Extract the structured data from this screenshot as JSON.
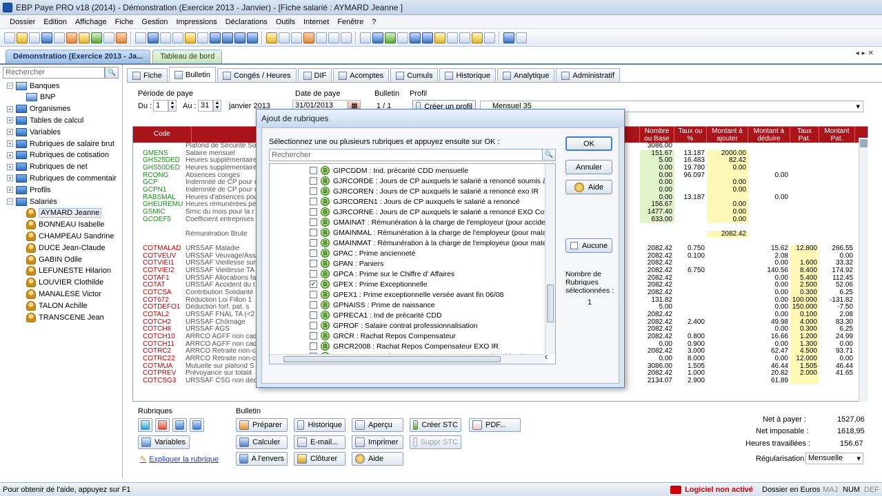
{
  "window": {
    "title": "EBP Paye PRO v18 (2014) - Démonstration (Exercice 2013 - Janvier) - [Fiche salarié : AYMARD Jeanne ]"
  },
  "menu": [
    "Dossier",
    "Edition",
    "Affichage",
    "Fiche",
    "Gestion",
    "Impressions",
    "Déclarations",
    "Outils",
    "Internet",
    "Fenêtre",
    "?"
  ],
  "doc_tabs": [
    {
      "label": "Démonstration (Exercice 2013 - Ja...",
      "active": true
    },
    {
      "label": "Tableau de bord",
      "active": false
    }
  ],
  "sidebar": {
    "search_placeholder": "Rechercher",
    "tree": [
      {
        "label": "Banques",
        "type": "bank",
        "expanded": true,
        "level": 0
      },
      {
        "label": "BNP",
        "type": "bank",
        "level": 1
      },
      {
        "label": "Organismes",
        "type": "folder",
        "level": 0
      },
      {
        "label": "Tables de calcul",
        "type": "folder",
        "level": 0
      },
      {
        "label": "Variables",
        "type": "folder",
        "level": 0
      },
      {
        "label": "Rubriques de salaire brut",
        "type": "folder",
        "level": 0
      },
      {
        "label": "Rubriques de cotisation",
        "type": "folder",
        "level": 0
      },
      {
        "label": "Rubriques de net",
        "type": "folder",
        "level": 0
      },
      {
        "label": "Rubriques de commentair",
        "type": "folder",
        "level": 0
      },
      {
        "label": "Profils",
        "type": "folder",
        "level": 0
      },
      {
        "label": "Salariés",
        "type": "folder",
        "expanded": true,
        "level": 0
      },
      {
        "label": "AYMARD Jeanne",
        "type": "person",
        "level": 1,
        "selected": true
      },
      {
        "label": "BONNEAU Isabelle",
        "type": "person",
        "level": 1
      },
      {
        "label": "CHAMPEAU Sandrine",
        "type": "person",
        "level": 1
      },
      {
        "label": "DUCE Jean-Claude",
        "type": "person",
        "level": 1
      },
      {
        "label": "GABIN Odile",
        "type": "person",
        "level": 1
      },
      {
        "label": "LEFUNESTE Hilarion",
        "type": "person",
        "level": 1
      },
      {
        "label": "LOUVIER Clothilde",
        "type": "person",
        "level": 1
      },
      {
        "label": "MANALESE Victor",
        "type": "person",
        "level": 1
      },
      {
        "label": "TALON Achille",
        "type": "person",
        "level": 1
      },
      {
        "label": "TRANSCENE Jean",
        "type": "person",
        "level": 1
      }
    ]
  },
  "sub_tabs": [
    "Fiche",
    "Bulletin",
    "Congés / Heures",
    "DIF",
    "Acomptes",
    "Cumuls",
    "Historique",
    "Analytique",
    "Administratif"
  ],
  "period": {
    "label": "Période de paye",
    "du_label": "Du :",
    "du": "1",
    "au_label": "Au :",
    "au": "31",
    "month": "janvier 2013",
    "date_label": "Date de paye",
    "date": "31/01/2013",
    "bulletin_label": "Bulletin",
    "bulletin": "1 / 1",
    "profil_label": "Profil",
    "create_profil": "Créer un profil",
    "profil": "Mensuel 35"
  },
  "grid": {
    "headers": {
      "code": "Code",
      "base": "Nombre ou Base",
      "taux": "Taux ou %",
      "ajouter": "Montant à ajouter",
      "deduire": "Montant à déduire",
      "tauxpat": "Taux Pat.",
      "montpat": "Montant Pat."
    },
    "rows": [
      {
        "code": "",
        "lib": "Plafond de Sécurité So",
        "base": "3086.00",
        "taux": "",
        "aj": "",
        "de": "",
        "tp": "",
        "mp": "",
        "g": false
      },
      {
        "code": "GMENS",
        "lib": "Salaire mensuel",
        "base": "151.67",
        "taux": "13.187",
        "aj": "2000.00",
        "de": "",
        "tp": "",
        "mp": "",
        "g": true
      },
      {
        "code": "GHS25DED",
        "lib": "Heures supplémentaire",
        "base": "5.00",
        "taux": "16.483",
        "aj": "82.42",
        "de": "",
        "tp": "",
        "mp": "",
        "g": true
      },
      {
        "code": "GHS50DED",
        "lib": "Heures supplémentaire",
        "base": "0.00",
        "taux": "19.780",
        "aj": "0.00",
        "de": "",
        "tp": "",
        "mp": "",
        "g": true
      },
      {
        "code": "RCONG",
        "lib": "Absences congés",
        "base": "0.00",
        "taux": "96.097",
        "aj": "",
        "de": "0.00",
        "tp": "",
        "mp": "",
        "g": true
      },
      {
        "code": "GCP",
        "lib": "Indemnité de CP pour c",
        "base": "0.00",
        "taux": "",
        "aj": "0.00",
        "de": "",
        "tp": "",
        "mp": "",
        "g": true
      },
      {
        "code": "GCPN1",
        "lib": "Indemnité de CP pour c",
        "base": "0.00",
        "taux": "",
        "aj": "0.00",
        "de": "",
        "tp": "",
        "mp": "",
        "g": true
      },
      {
        "code": "RABSMAL",
        "lib": "Heures d'absences pou",
        "base": "0.00",
        "taux": "13.187",
        "aj": "",
        "de": "0.00",
        "tp": "",
        "mp": "",
        "g": true
      },
      {
        "code": "GHEUREMU",
        "lib": "Heures rémunérées pe",
        "base": "156.67",
        "taux": "",
        "aj": "0.00",
        "de": "",
        "tp": "",
        "mp": "",
        "g": true
      },
      {
        "code": "GSMIC",
        "lib": "Smic du mois pour la r",
        "base": "1477.40",
        "taux": "",
        "aj": "0.00",
        "de": "",
        "tp": "",
        "mp": "",
        "g": true
      },
      {
        "code": "GCOEF5",
        "lib": "Coefficient entreprises",
        "base": "633.00",
        "taux": "",
        "aj": "0.00",
        "de": "",
        "tp": "",
        "mp": "",
        "g": true
      },
      {
        "code": "",
        "lib": "",
        "base": "",
        "taux": "",
        "aj": "",
        "de": "",
        "tp": "",
        "mp": "",
        "g": false
      },
      {
        "code": "",
        "lib": "Rémunération Brute",
        "base": "",
        "taux": "",
        "aj": "2082.42",
        "de": "",
        "tp": "",
        "mp": "",
        "g": false
      },
      {
        "code": "",
        "lib": "",
        "base": "",
        "taux": "",
        "aj": "",
        "de": "",
        "tp": "",
        "mp": "",
        "g": false
      },
      {
        "code": "COTMALAD",
        "lib": "URSSAF Maladie",
        "base": "2082.42",
        "taux": "0.750",
        "aj": "",
        "de": "15.62",
        "tp": "12.800",
        "mp": "266.55",
        "g": false
      },
      {
        "code": "COTVEUV",
        "lib": "URSSAF Veuvage/Ass",
        "base": "2082.42",
        "taux": "0.100",
        "aj": "",
        "de": "2.08",
        "tp": "",
        "mp": "0.00",
        "g": false
      },
      {
        "code": "COTVIEI1",
        "lib": "URSSAF Vieillesse sur",
        "base": "2082.42",
        "taux": "",
        "aj": "",
        "de": "0.00",
        "tp": "1.600",
        "mp": "33.32",
        "g": false
      },
      {
        "code": "COTVIEI2",
        "lib": "URSSAF Vieillesse TA",
        "base": "2082.42",
        "taux": "6.750",
        "aj": "",
        "de": "140.56",
        "tp": "8.400",
        "mp": "174.92",
        "g": false
      },
      {
        "code": "COTAF1",
        "lib": "URSSAF Allocations fa",
        "base": "2082.42",
        "taux": "",
        "aj": "",
        "de": "0.00",
        "tp": "5.400",
        "mp": "112.45",
        "g": false
      },
      {
        "code": "COTAT",
        "lib": "URSSAF Accident du t",
        "base": "2082.42",
        "taux": "",
        "aj": "",
        "de": "0.00",
        "tp": "2.500",
        "mp": "52.06",
        "g": false
      },
      {
        "code": "COTCSA",
        "lib": "Contribution Solidarité",
        "base": "2082.42",
        "taux": "",
        "aj": "",
        "de": "0.00",
        "tp": "0.300",
        "mp": "6.25",
        "g": false
      },
      {
        "code": "COT672",
        "lib": "Réduction Loi Fillon 1",
        "base": "131.82",
        "taux": "",
        "aj": "",
        "de": "0.00",
        "tp": "100.000",
        "mp": "-131.82",
        "g": false
      },
      {
        "code": "COTDEFO1",
        "lib": "Déduction forf. pat. s",
        "base": "5.00",
        "taux": "",
        "aj": "",
        "de": "0.00",
        "tp": "150.000",
        "mp": "-7.50",
        "g": false
      },
      {
        "code": "COTAL2",
        "lib": "URSSAF FNAL TA (<2",
        "base": "2082.42",
        "taux": "",
        "aj": "",
        "de": "0.00",
        "tp": "0.100",
        "mp": "2.08",
        "g": false
      },
      {
        "code": "COTCH2",
        "lib": "URSSAF Chômage",
        "base": "2082.42",
        "taux": "2.400",
        "aj": "",
        "de": "49.98",
        "tp": "4.000",
        "mp": "83.30",
        "g": false
      },
      {
        "code": "COTCH8",
        "lib": "URSSAF AGS",
        "base": "2082.42",
        "taux": "",
        "aj": "",
        "de": "0.00",
        "tp": "0.300",
        "mp": "6.25",
        "g": false
      },
      {
        "code": "COTCH10",
        "lib": "ARRCO AGFF non cad",
        "base": "2082.42",
        "taux": "0.800",
        "aj": "",
        "de": "16.66",
        "tp": "1.200",
        "mp": "24.99",
        "g": false
      },
      {
        "code": "COTCH11",
        "lib": "ARRCO AGFF non cad",
        "base": "0.00",
        "taux": "0.900",
        "aj": "",
        "de": "0.00",
        "tp": "1.300",
        "mp": "0.00",
        "g": false
      },
      {
        "code": "COTRC2",
        "lib": "ARRCO Retraite non-c",
        "base": "2082.42",
        "taux": "3.000",
        "aj": "",
        "de": "62.47",
        "tp": "4.500",
        "mp": "93.71",
        "g": false
      },
      {
        "code": "COTRC22",
        "lib": "ARRCO Retraite non-c",
        "base": "0.00",
        "taux": "8.000",
        "aj": "",
        "de": "0.00",
        "tp": "12.000",
        "mp": "0.00",
        "g": false
      },
      {
        "code": "COTMUA",
        "lib": "Mutuelle sur plafond S",
        "base": "3086.00",
        "taux": "1.505",
        "aj": "",
        "de": "46.44",
        "tp": "1.505",
        "mp": "46.44",
        "g": false
      },
      {
        "code": "COTPREV",
        "lib": "Prévoyance sur totalit",
        "base": "2082.42",
        "taux": "1.000",
        "aj": "",
        "de": "20.82",
        "tp": "2.000",
        "mp": "41.65",
        "g": false
      },
      {
        "code": "COTCSG3",
        "lib": "URSSAF CSG non déductible + CRDS",
        "base": "2134.07",
        "taux": "2.900",
        "aj": "",
        "de": "61.89",
        "tp": "",
        "mp": "",
        "g": false
      }
    ]
  },
  "rubriques": {
    "label": "Rubriques",
    "variables": "Variables",
    "expliquer": "Expliquer la rubrique"
  },
  "bulletin_actions": {
    "label": "Bulletin",
    "preparer": "Préparer",
    "historique": "Historique",
    "apercu": "Aperçu",
    "creer_stc": "Créer STC",
    "pdf": "PDF...",
    "calculer": "Calculer",
    "email": "E-mail...",
    "imprimer": "Imprimer",
    "suppr_stc": "Suppr STC",
    "envers": "A l'envers",
    "cloturer": "Clôturer",
    "aide": "Aide"
  },
  "totals": {
    "net_label": "Net à payer :",
    "net": "1527,06",
    "imposable_label": "Net imposable :",
    "imposable": "1618,95",
    "heures_label": "Heures travaillées :",
    "heures": "156,67",
    "regul_label": "Régularisation :",
    "regul": "Mensuelle"
  },
  "status": {
    "help": "Pour obtenir de l'aide, appuyez sur F1",
    "licence": "Logiciel non activé",
    "currency": "Dossier en Euros",
    "maj": "MAJ",
    "num": "NUM",
    "def": "DEF"
  },
  "dialog": {
    "title": "Ajout de rubriques",
    "instruction": "Sélectionnez une ou plusieurs rubriques et appuyez ensuite sur OK :",
    "search_placeholder": "Rechercher",
    "items": [
      {
        "text": "GIPCDDM : Ind. précarité CDD mensuelle",
        "checked": false
      },
      {
        "text": "GJRCORDE : Jours de CP auxquels le salarié a renoncé soumis à déduction",
        "checked": false
      },
      {
        "text": "GJRCOREN : Jours de CP auxquels le salarié a renoncé exo IR",
        "checked": false
      },
      {
        "text": "GJRCOREN1 : Jours de CP auxquels le salarié a renoncé",
        "checked": false
      },
      {
        "text": "GJRCORNE : Jours de CP auxquels le salarié a renoncé EXO Cotisations",
        "checked": false
      },
      {
        "text": "GMAINAT : Rémunération à la charge de l'employeur (pour accident du travail)",
        "checked": false
      },
      {
        "text": "GMAINMAL : Rémunération à la charge de l'employeur (pour maladie)",
        "checked": false
      },
      {
        "text": "GMAINMAT : Rémunération à la charge de l'employeur (pour maternité)",
        "checked": false
      },
      {
        "text": "GPAC : Prime ancienneté",
        "checked": false
      },
      {
        "text": "GPAN : Paniers",
        "checked": false
      },
      {
        "text": "GPCA : Prime sur le Chiffre d' Affaires",
        "checked": false
      },
      {
        "text": "GPEX : Prime Exceptionnelle",
        "checked": true
      },
      {
        "text": "GPEX1 : Prime exceptionnelle versée avant fin 06/08",
        "checked": false
      },
      {
        "text": "GPNAISS : Prime de naissance",
        "checked": false
      },
      {
        "text": "GPRECA1 : Ind de précarité CDD",
        "checked": false
      },
      {
        "text": "GPROF : Salaire contrat professionnalisation",
        "checked": false
      },
      {
        "text": "GRCR : Rachat Repos Compensateur",
        "checked": false
      },
      {
        "text": "GRCR2008 : Rachat Repos Compensateur EXO IR",
        "checked": false
      },
      {
        "text": "GRCRDED : Rachat Repos Compensateur soumis Déduction patronale",
        "checked": false
      }
    ],
    "ok": "OK",
    "annuler": "Annuler",
    "aide": "Aide",
    "aucune": "Aucune",
    "count_label": "Nombre de Rubriques sélectionnées :",
    "count": "1"
  }
}
